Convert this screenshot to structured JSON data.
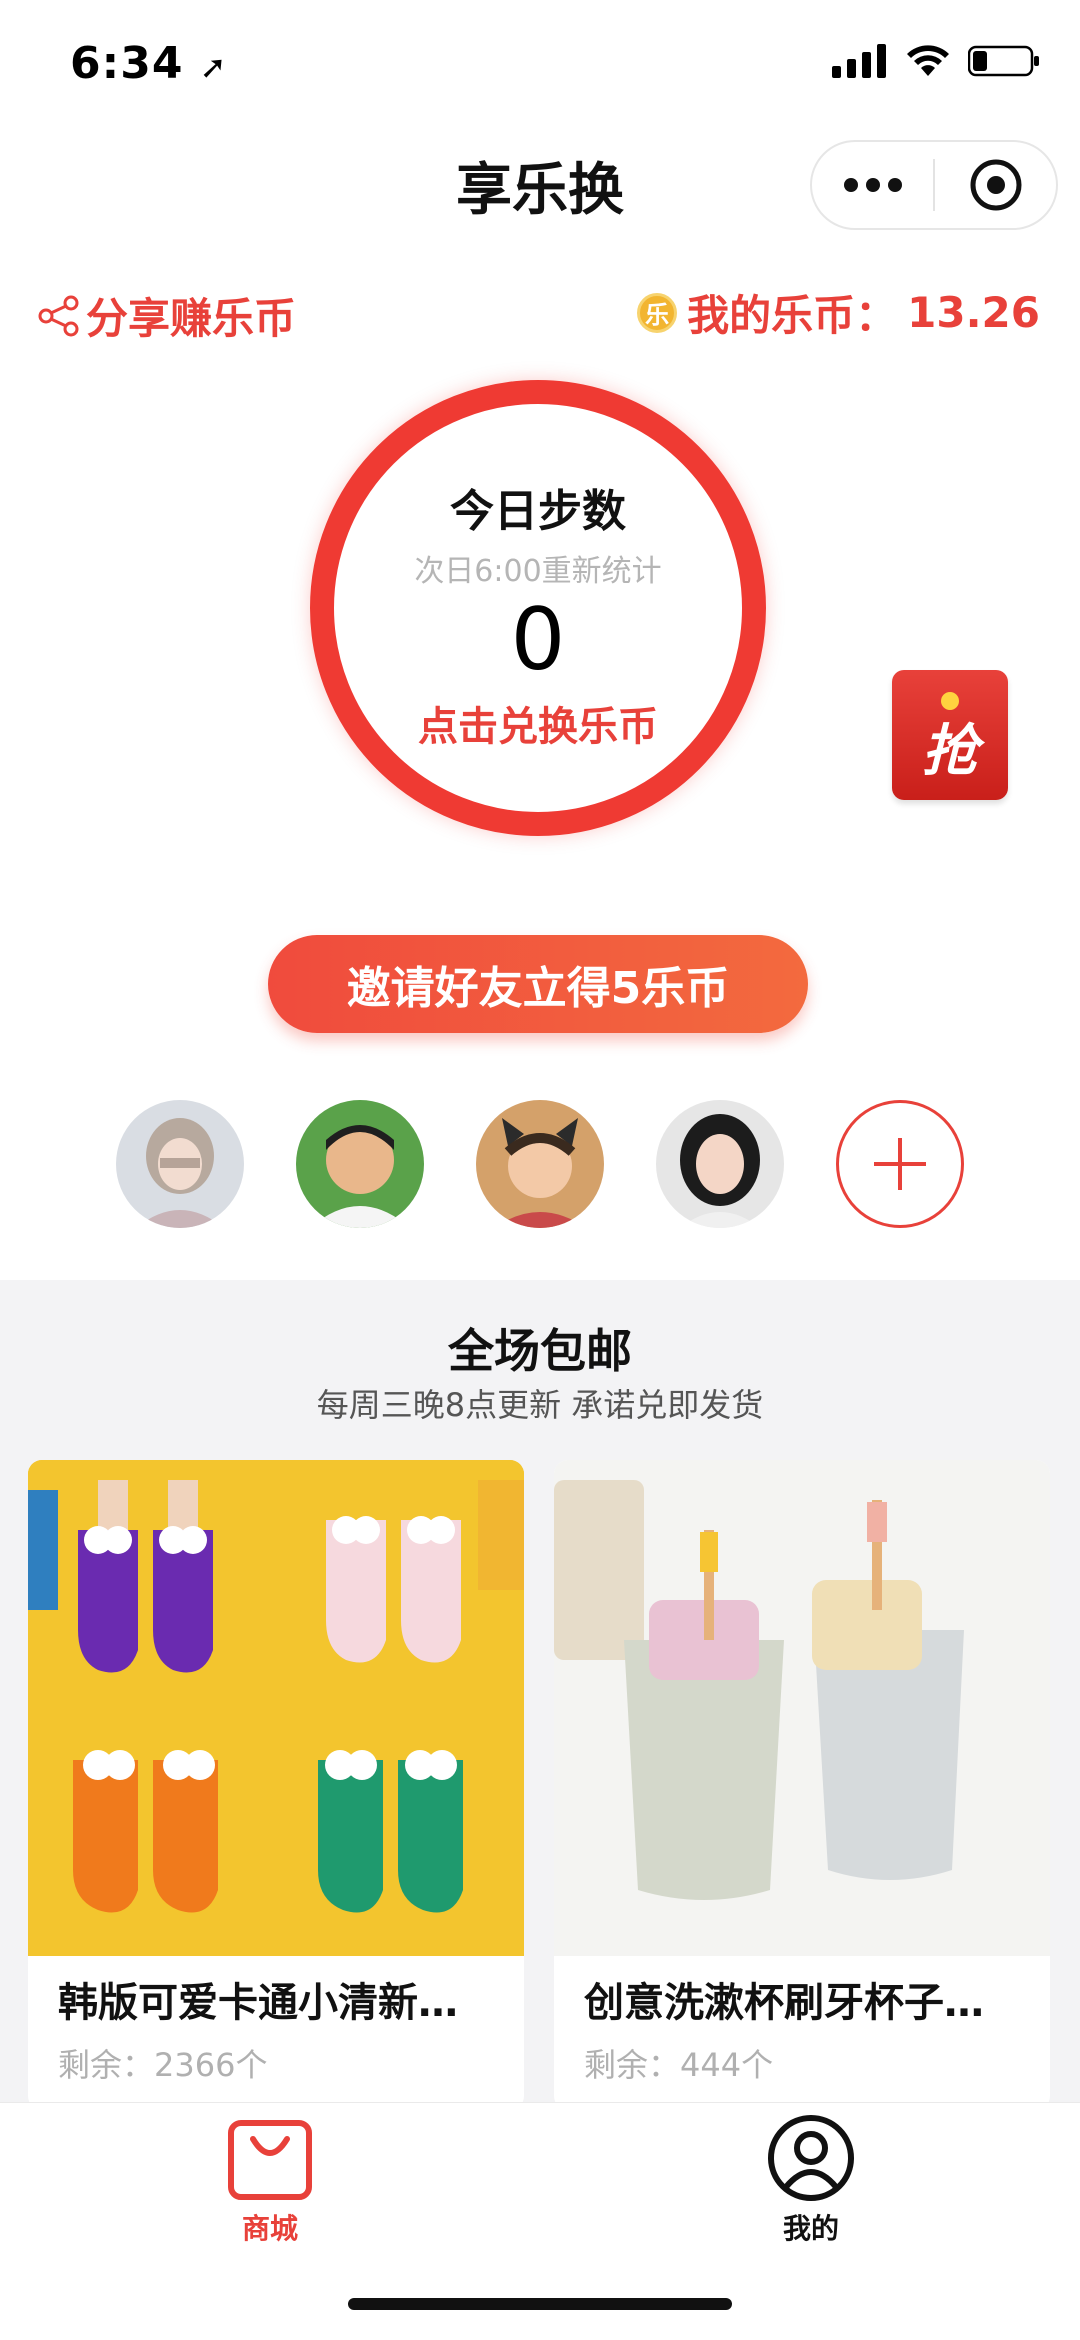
{
  "status_bar": {
    "time": "6:34"
  },
  "nav": {
    "title": "享乐换"
  },
  "header": {
    "share_label": "分享赚乐币",
    "coin_label": "我的乐币：",
    "coin_value": "13.26",
    "coin_badge": "乐"
  },
  "steps": {
    "title": "今日步数",
    "reset_note": "次日6:00重新统计",
    "count": "0",
    "action": "点击兑换乐币"
  },
  "grab_badge": "抢",
  "invite": {
    "button_label": "邀请好友立得5乐币"
  },
  "friends": [
    {
      "name": "friend-1"
    },
    {
      "name": "friend-2"
    },
    {
      "name": "friend-3"
    },
    {
      "name": "friend-4"
    }
  ],
  "promo": {
    "title": "全场包邮",
    "subtitle": "每周三晚8点更新 承诺兑即发货"
  },
  "products": [
    {
      "name": "韩版可爱卡通小清新…",
      "remaining": "剩余：2366个"
    },
    {
      "name": "创意洗漱杯刷牙杯子…",
      "remaining": "剩余：444个"
    }
  ],
  "tabbar": {
    "tabs": [
      {
        "label": "商城",
        "icon": "shopping-bag-icon",
        "active": true
      },
      {
        "label": "我的",
        "icon": "user-icon",
        "active": false
      }
    ]
  },
  "colors": {
    "accent": "#e8413a",
    "ring": "#ef3a33",
    "coin": "#f2b530",
    "section_bg": "#f3f3f5"
  }
}
